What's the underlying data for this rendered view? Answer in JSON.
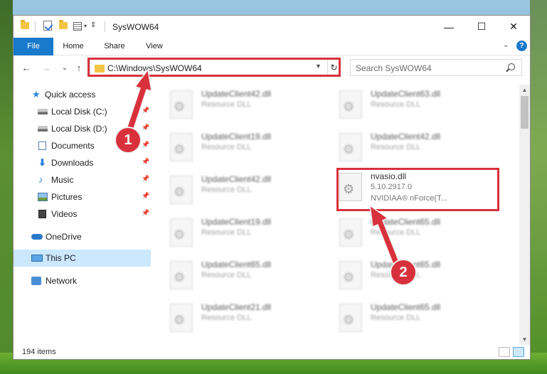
{
  "window": {
    "title": "SysWOW64",
    "controls": {
      "minimize": "—",
      "maximize": "☐",
      "close": "✕"
    }
  },
  "ribbon": {
    "tabs": [
      "File",
      "Home",
      "Share",
      "View"
    ],
    "collapse_icon": "chevron-down-icon",
    "help_label": "?"
  },
  "nav": {
    "back": "←",
    "forward": "→",
    "recent": "⌄",
    "up": "↑",
    "address": "C:\\Windows\\SysWOW64",
    "search_placeholder": "Search SysWOW64"
  },
  "sidebar": {
    "items": [
      {
        "label": "Quick access",
        "icon": "star-icon",
        "pinned": false
      },
      {
        "label": "Local Disk (C:)",
        "icon": "disk-icon",
        "pinned": true
      },
      {
        "label": "Local Disk (D:)",
        "icon": "disk-icon",
        "pinned": true
      },
      {
        "label": "Documents",
        "icon": "document-icon",
        "pinned": true
      },
      {
        "label": "Downloads",
        "icon": "download-icon",
        "pinned": true
      },
      {
        "label": "Music",
        "icon": "music-icon",
        "pinned": true
      },
      {
        "label": "Pictures",
        "icon": "pictures-icon",
        "pinned": true
      },
      {
        "label": "Videos",
        "icon": "videos-icon",
        "pinned": true
      },
      {
        "label": "OneDrive",
        "icon": "cloud-icon",
        "pinned": false
      },
      {
        "label": "This PC",
        "icon": "computer-icon",
        "pinned": false,
        "selected": true
      },
      {
        "label": "Network",
        "icon": "network-icon",
        "pinned": false
      }
    ]
  },
  "files": {
    "left_column": [
      {
        "name": "UpdateClient42.dll",
        "type": "Resource DLL"
      },
      {
        "name": "UpdateClient19.dll",
        "type": "Resource DLL"
      },
      {
        "name": "UpdateClient42.dll",
        "type": "Resource DLL"
      },
      {
        "name": "UpdateClient19.dll",
        "type": "Resource DLL"
      },
      {
        "name": "UpdateClient65.dll",
        "type": "Resource DLL"
      },
      {
        "name": "UpdateClient21.dll",
        "type": "Resource DLL"
      }
    ],
    "right_column": [
      {
        "name": "UpdateClient63.dll",
        "type": "Resource DLL"
      },
      {
        "name": "UpdateClient42.dll",
        "type": "Resource DLL"
      },
      {
        "name": "nvasio.dll",
        "version": "5.10.2917.0",
        "description": "NVIDIAA® nForce(T...",
        "highlighted": true
      },
      {
        "name": "UpdateClient65.dll",
        "type": "Resource DLL"
      },
      {
        "name": "UpdateClient65.dll",
        "type": "Resource DLL"
      },
      {
        "name": "UpdateClient65.dll",
        "type": "Resource DLL"
      }
    ]
  },
  "status": {
    "item_count": "194 items"
  },
  "annotations": {
    "callout_1": "1",
    "callout_2": "2",
    "highlight_color": "#d8313b"
  },
  "colors": {
    "accent": "#1979ca",
    "selection": "#cce8ff"
  }
}
